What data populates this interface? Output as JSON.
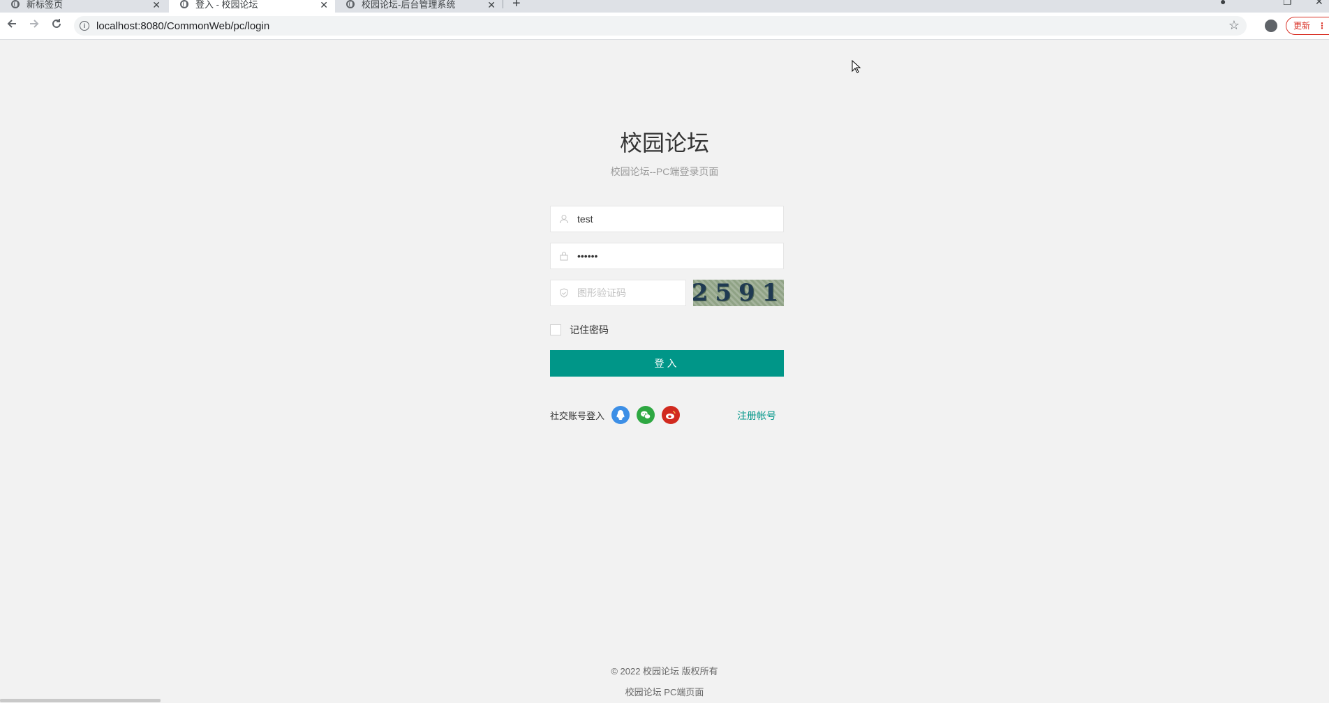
{
  "browser": {
    "tabs": [
      {
        "title": "新标签页",
        "active": false
      },
      {
        "title": "登入 - 校园论坛",
        "active": true
      },
      {
        "title": "校园论坛-后台管理系统",
        "active": false
      }
    ],
    "url": "localhost:8080/CommonWeb/pc/login",
    "update_label": "更新"
  },
  "page": {
    "title": "校园论坛",
    "subtitle": "校园论坛--PC端登录页面"
  },
  "form": {
    "username_value": "test",
    "password_value": "••••••",
    "captcha_placeholder": "图形验证码",
    "captcha_text": "2591",
    "remember_label": "记住密码",
    "login_label": "登入"
  },
  "social": {
    "label": "社交账号登入",
    "icons": [
      "qq-icon",
      "wechat-icon",
      "weibo-icon"
    ],
    "register_label": "注册帐号"
  },
  "footer": {
    "copyright": "© 2022 校园论坛 版权所有",
    "note": "校园论坛 PC端页面"
  },
  "colors": {
    "primary": "#009688",
    "background": "#f2f2f2",
    "qq": "#3d8fe6",
    "wechat": "#2ea842",
    "weibo": "#d12a1f"
  }
}
